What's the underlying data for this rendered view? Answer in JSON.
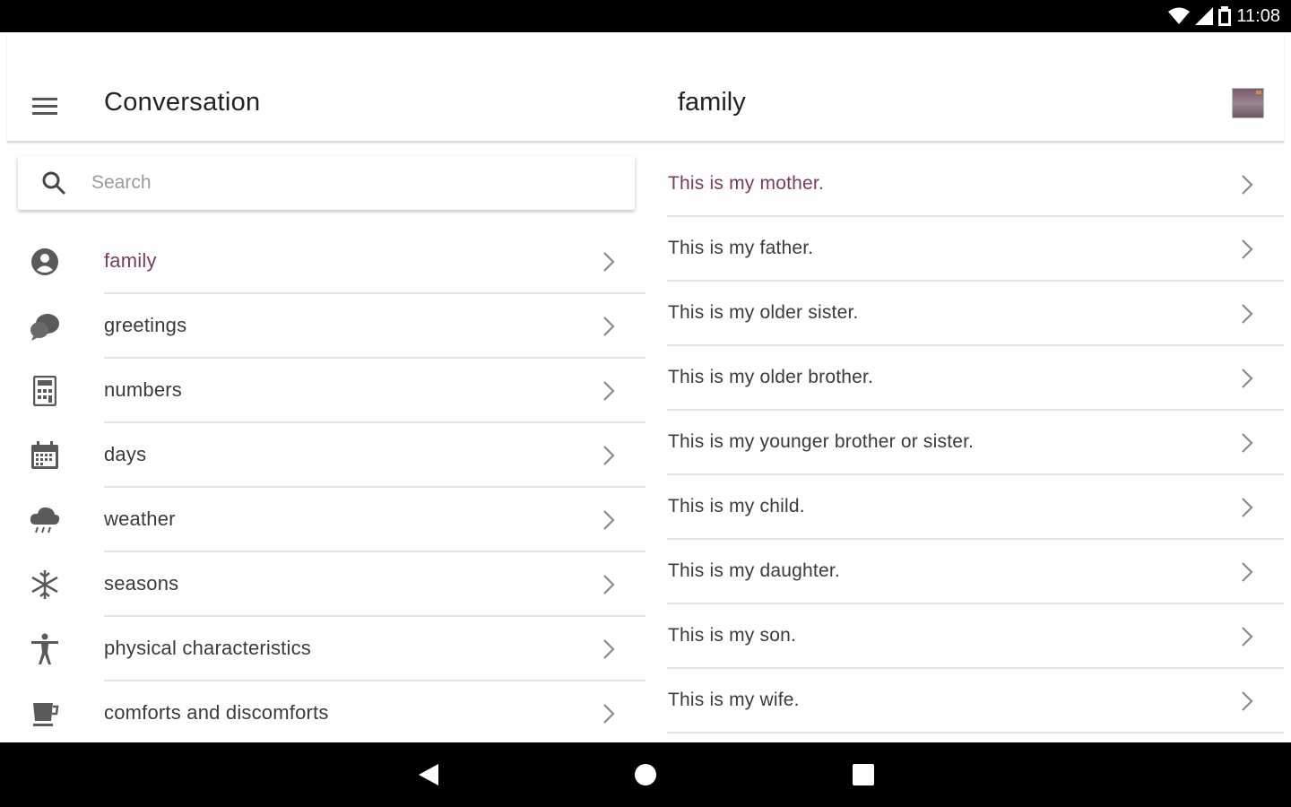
{
  "status_bar": {
    "time": "11:08"
  },
  "toolbar": {
    "title": "Conversation",
    "detail_title": "family"
  },
  "search": {
    "placeholder": "Search"
  },
  "categories": [
    {
      "label": "family",
      "icon": "account-circle-icon",
      "active": true
    },
    {
      "label": "greetings",
      "icon": "chat-bubbles-icon"
    },
    {
      "label": "numbers",
      "icon": "calculator-icon"
    },
    {
      "label": "days",
      "icon": "calendar-icon"
    },
    {
      "label": "weather",
      "icon": "rain-cloud-icon"
    },
    {
      "label": "seasons",
      "icon": "snowflake-icon"
    },
    {
      "label": "physical characteristics",
      "icon": "accessibility-icon"
    },
    {
      "label": "comforts and discomforts",
      "icon": "coffee-cup-icon"
    }
  ],
  "phrases": [
    {
      "label": "This is my mother.",
      "active": true
    },
    {
      "label": "This is my father."
    },
    {
      "label": "This is my older sister."
    },
    {
      "label": "This is my older brother."
    },
    {
      "label": "This is my younger brother or sister."
    },
    {
      "label": "This is my child."
    },
    {
      "label": "This is my daughter."
    },
    {
      "label": "This is my son."
    },
    {
      "label": "This is my wife."
    }
  ],
  "colors": {
    "accent": "#7b3a5e",
    "divider": "#e4e4e4",
    "text": "#3a3a3a"
  }
}
